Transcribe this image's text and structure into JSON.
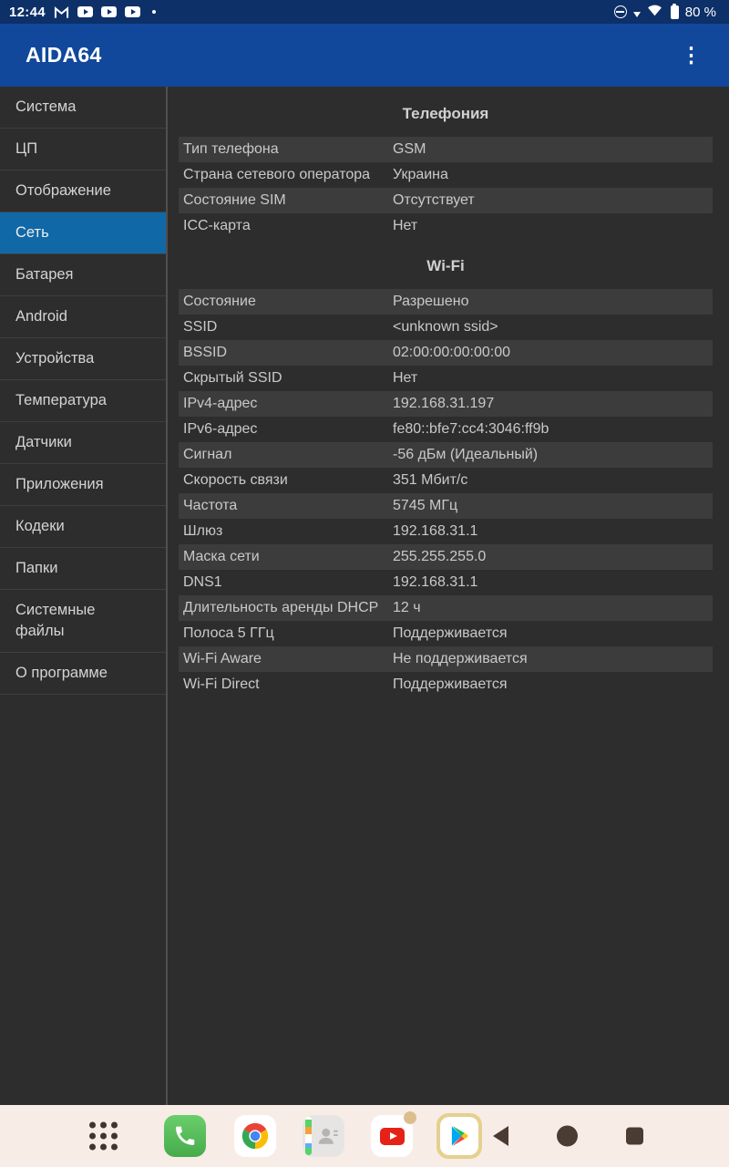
{
  "status_bar": {
    "time": "12:44",
    "battery": "80 %",
    "left_icons": [
      "gmail-notification-icon",
      "youtube-notification-icon",
      "youtube-notification-icon",
      "youtube-notification-icon",
      "more-notifications-dot"
    ],
    "right_icons": [
      "do-not-disturb-icon",
      "vpn-triangle-icon",
      "wifi-icon",
      "battery-icon"
    ]
  },
  "app_bar": {
    "title": "AIDA64",
    "menu_icon": "kebab-menu-icon"
  },
  "sidebar": {
    "items": [
      {
        "id": "system",
        "label": "Система",
        "selected": false
      },
      {
        "id": "cpu",
        "label": "ЦП",
        "selected": false
      },
      {
        "id": "display",
        "label": "Отображение",
        "selected": false
      },
      {
        "id": "network",
        "label": "Сеть",
        "selected": true
      },
      {
        "id": "battery",
        "label": "Батарея",
        "selected": false
      },
      {
        "id": "android",
        "label": "Android",
        "selected": false
      },
      {
        "id": "devices",
        "label": "Устройства",
        "selected": false
      },
      {
        "id": "temperature",
        "label": "Температура",
        "selected": false
      },
      {
        "id": "sensors",
        "label": "Датчики",
        "selected": false
      },
      {
        "id": "apps",
        "label": "Приложения",
        "selected": false
      },
      {
        "id": "codecs",
        "label": "Кодеки",
        "selected": false
      },
      {
        "id": "folders",
        "label": "Папки",
        "selected": false
      },
      {
        "id": "system-files",
        "label": "Системные файлы",
        "selected": false
      },
      {
        "id": "about",
        "label": "О программе",
        "selected": false
      }
    ]
  },
  "content": {
    "sections": [
      {
        "title": "Телефония",
        "rows": [
          {
            "label": "Тип телефона",
            "value": "GSM"
          },
          {
            "label": "Страна сетевого оператора",
            "value": "Украина"
          },
          {
            "label": "Состояние SIM",
            "value": "Отсутствует"
          },
          {
            "label": "ICC-карта",
            "value": "Нет"
          }
        ]
      },
      {
        "title": "Wi-Fi",
        "rows": [
          {
            "label": "Состояние",
            "value": "Разрешено"
          },
          {
            "label": "SSID",
            "value": "<unknown ssid>"
          },
          {
            "label": "BSSID",
            "value": "02:00:00:00:00:00"
          },
          {
            "label": "Скрытый SSID",
            "value": "Нет"
          },
          {
            "label": "IPv4-адрес",
            "value": "192.168.31.197"
          },
          {
            "label": "IPv6-адрес",
            "value": "fe80::bfe7:cc4:3046:ff9b"
          },
          {
            "label": "Сигнал",
            "value": "-56 дБм (Идеальный)"
          },
          {
            "label": "Скорость связи",
            "value": "351 Мбит/с"
          },
          {
            "label": "Частота",
            "value": "5745 МГц"
          },
          {
            "label": "Шлюз",
            "value": "192.168.31.1"
          },
          {
            "label": "Маска сети",
            "value": "255.255.255.0"
          },
          {
            "label": "DNS1",
            "value": "192.168.31.1"
          },
          {
            "label": "Длительность аренды DHCP",
            "value": "12 ч"
          },
          {
            "label": "Полоса 5 ГГц",
            "value": "Поддерживается"
          },
          {
            "label": "Wi-Fi Aware",
            "value": "Не поддерживается"
          },
          {
            "label": "Wi-Fi Direct",
            "value": "Поддерживается"
          }
        ]
      }
    ]
  },
  "nav_bar": {
    "app_icons": [
      "app-drawer-icon",
      "phone-icon",
      "chrome-icon",
      "contacts-icon",
      "youtube-icon",
      "play-store-icon"
    ],
    "system_icons": [
      "back-icon",
      "home-icon",
      "recents-icon"
    ],
    "youtube_has_badge": true,
    "play_store_highlighted": true
  },
  "colors": {
    "status_bar_bg": "#0d3068",
    "app_bar_bg": "#11489b",
    "selected_item_bg": "#1168a6",
    "background": "#2d2d2d",
    "row_stripe": "#3c3c3c",
    "text": "#c9c9c9",
    "nav_bar_bg": "#f8ece6"
  }
}
